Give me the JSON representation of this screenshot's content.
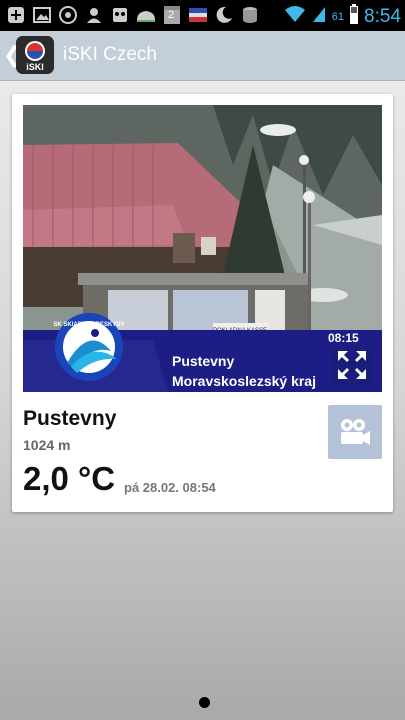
{
  "status_bar": {
    "icons": [
      "plus-icon",
      "image-icon",
      "browser-icon",
      "avatar-icon",
      "alien-icon",
      "cloud-icon",
      "calendar-2-icon",
      "flag-icon",
      "moon-icon",
      "storage-icon",
      "wifi-icon",
      "signal-icon",
      "battery-icon"
    ],
    "calendar_day": "2",
    "battery_percent": "61",
    "time": "8:54",
    "accent_color": "#3fb8e8"
  },
  "app_bar": {
    "back_glyph": "❮",
    "title": "iSKI Czech",
    "logo_text": "iSKI"
  },
  "webcam": {
    "brand_text": "SK SKIAREAL BESKYDY",
    "sign_text": "POKLADNA KASSE",
    "timestamp": "08:15",
    "location_line1": "Pustevny",
    "location_line2": "Moravskoslezský kraj",
    "banner_color": "#1c1e86"
  },
  "resort": {
    "name": "Pustevny",
    "altitude": "1024 m",
    "temperature": "2,0 °C",
    "datetime": "pá 28.02. 08:54"
  },
  "pager": {
    "pages": 1,
    "current": 1
  }
}
